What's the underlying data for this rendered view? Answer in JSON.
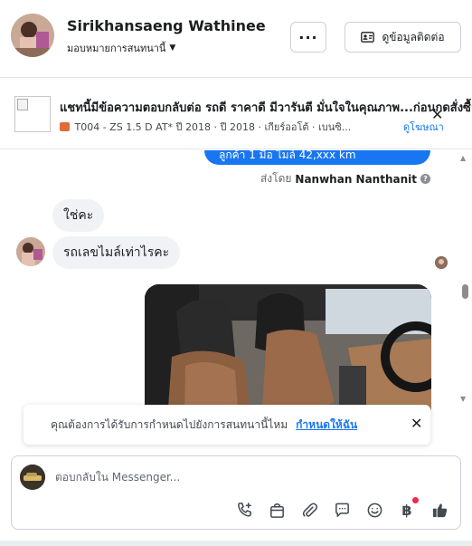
{
  "header": {
    "name": "Sirikhansaeng Wathinee",
    "assign_label": "มอบหมายการสนทนานี้",
    "more_label": "···",
    "contact_label": "ดูข้อมูลติดต่อ"
  },
  "ad": {
    "title": "แชทนี้มีข้อความตอบกลับต่อ รถดี ราคาดี มีวารันตี มั่นใจในคุณภาพ...ก่อนกดสั่งซื้อ",
    "meta": "T004 - ZS 1.5 D AT* ปี 2018 · ปี 2018 · เกียร์ออโต้ · เบนซิ...",
    "link_label": "ดูโฆษณา",
    "colors": {
      "car_icon": "#e06c3a",
      "cal_icon": "#5b7bd5",
      "gear_icon": "#9e7be0",
      "fuel_icon": "#444950"
    }
  },
  "chat": {
    "sent_text": "ลูกค้า 1 มือ ไมล์ 42,xxx km",
    "sent_by_prefix": "ส่งโดย",
    "sent_by_name": "Nanwhan Nanthanit",
    "messages": [
      {
        "text": "ใช่คะ"
      },
      {
        "text": "รถเลขไมล์เท่าไรคะ"
      }
    ]
  },
  "reminder": {
    "text": "คุณต้องการได้รับการกำหนดไปยังการสนทนานี้ไหม",
    "link": "กำหนดให้ฉัน"
  },
  "composer": {
    "placeholder": "ตอบกลับใน Messenger...",
    "tools": [
      "call-add-icon",
      "shopping-bag-icon",
      "attach-icon",
      "saved-reply-icon",
      "emoji-icon",
      "baht-icon",
      "like-icon"
    ],
    "baht_symbol": "฿"
  },
  "colors": {
    "accent": "#1876f2",
    "bubble": "#f0f2f5",
    "badge": "#f02849"
  }
}
